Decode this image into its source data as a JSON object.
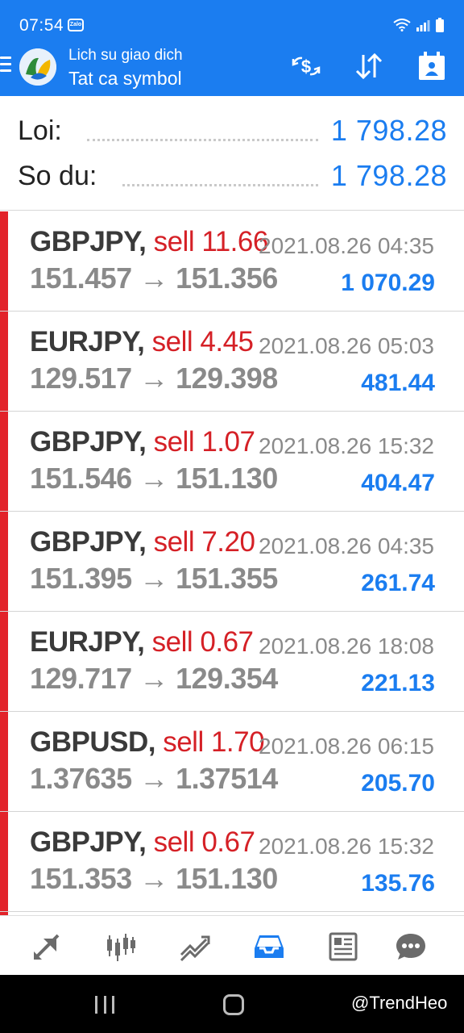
{
  "status_bar": {
    "time": "07:54",
    "notification_app": "Zalo"
  },
  "header": {
    "title": "Lich su giao dich",
    "subtitle": "Tat ca symbol"
  },
  "summary": [
    {
      "label": "Loi:",
      "value": "1 798.28"
    },
    {
      "label": "So du:",
      "value": "1 798.28"
    }
  ],
  "trades": [
    {
      "symbol": "GBPJPY,",
      "side": "sell 11.66",
      "datetime": "2021.08.26 04:35",
      "prices": "151.457 → 151.356",
      "profit": "1 070.29"
    },
    {
      "symbol": "EURJPY,",
      "side": "sell 4.45",
      "datetime": "2021.08.26 05:03",
      "prices": "129.517 → 129.398",
      "profit": "481.44"
    },
    {
      "symbol": "GBPJPY,",
      "side": "sell 1.07",
      "datetime": "2021.08.26 15:32",
      "prices": "151.546 → 151.130",
      "profit": "404.47"
    },
    {
      "symbol": "GBPJPY,",
      "side": "sell 7.20",
      "datetime": "2021.08.26 04:35",
      "prices": "151.395 → 151.355",
      "profit": "261.74"
    },
    {
      "symbol": "EURJPY,",
      "side": "sell 0.67",
      "datetime": "2021.08.26 18:08",
      "prices": "129.717 → 129.354",
      "profit": "221.13"
    },
    {
      "symbol": "GBPUSD,",
      "side": "sell 1.70",
      "datetime": "2021.08.26 06:15",
      "prices": "1.37635 → 1.37514",
      "profit": "205.70"
    },
    {
      "symbol": "GBPJPY,",
      "side": "sell 0.67",
      "datetime": "2021.08.26 15:32",
      "prices": "151.353 → 151.130",
      "profit": "135.76"
    }
  ],
  "bottom_nav": [
    {
      "icon": "quotes-arrows-icon",
      "active": false
    },
    {
      "icon": "candlestick-chart-icon",
      "active": false
    },
    {
      "icon": "trade-chart-icon",
      "active": false
    },
    {
      "icon": "history-inbox-icon",
      "active": true
    },
    {
      "icon": "news-icon",
      "active": false
    },
    {
      "icon": "chat-icon",
      "active": false
    }
  ],
  "watermark": "@TrendHeo",
  "colors": {
    "accent": "#1b7df0",
    "sell": "#d52026",
    "trade_bar": "#e2232a"
  }
}
